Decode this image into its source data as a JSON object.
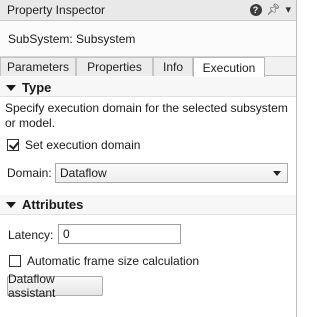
{
  "window": {
    "title": "Property Inspector",
    "help_icon": "help-icon",
    "pin_icon": "pin-icon",
    "menu_icon": "menu-icon"
  },
  "subsystem": {
    "label": "SubSystem: Subsystem"
  },
  "tabs": [
    {
      "label": "Parameters",
      "active": false
    },
    {
      "label": "Properties",
      "active": false
    },
    {
      "label": "Info",
      "active": false
    },
    {
      "label": "Execution",
      "active": true
    }
  ],
  "type_section": {
    "title": "Type",
    "description": "Specify execution domain for the selected subsystem or model.",
    "set_domain_label": "Set execution domain",
    "set_domain_checked": true,
    "domain_label": "Domain:",
    "domain_value": "Dataflow"
  },
  "attributes_section": {
    "title": "Attributes",
    "latency_label": "Latency:",
    "latency_value": "0",
    "auto_frame_label": "Automatic frame size calculation",
    "auto_frame_checked": false,
    "assistant_button": "Dataflow assistant"
  }
}
